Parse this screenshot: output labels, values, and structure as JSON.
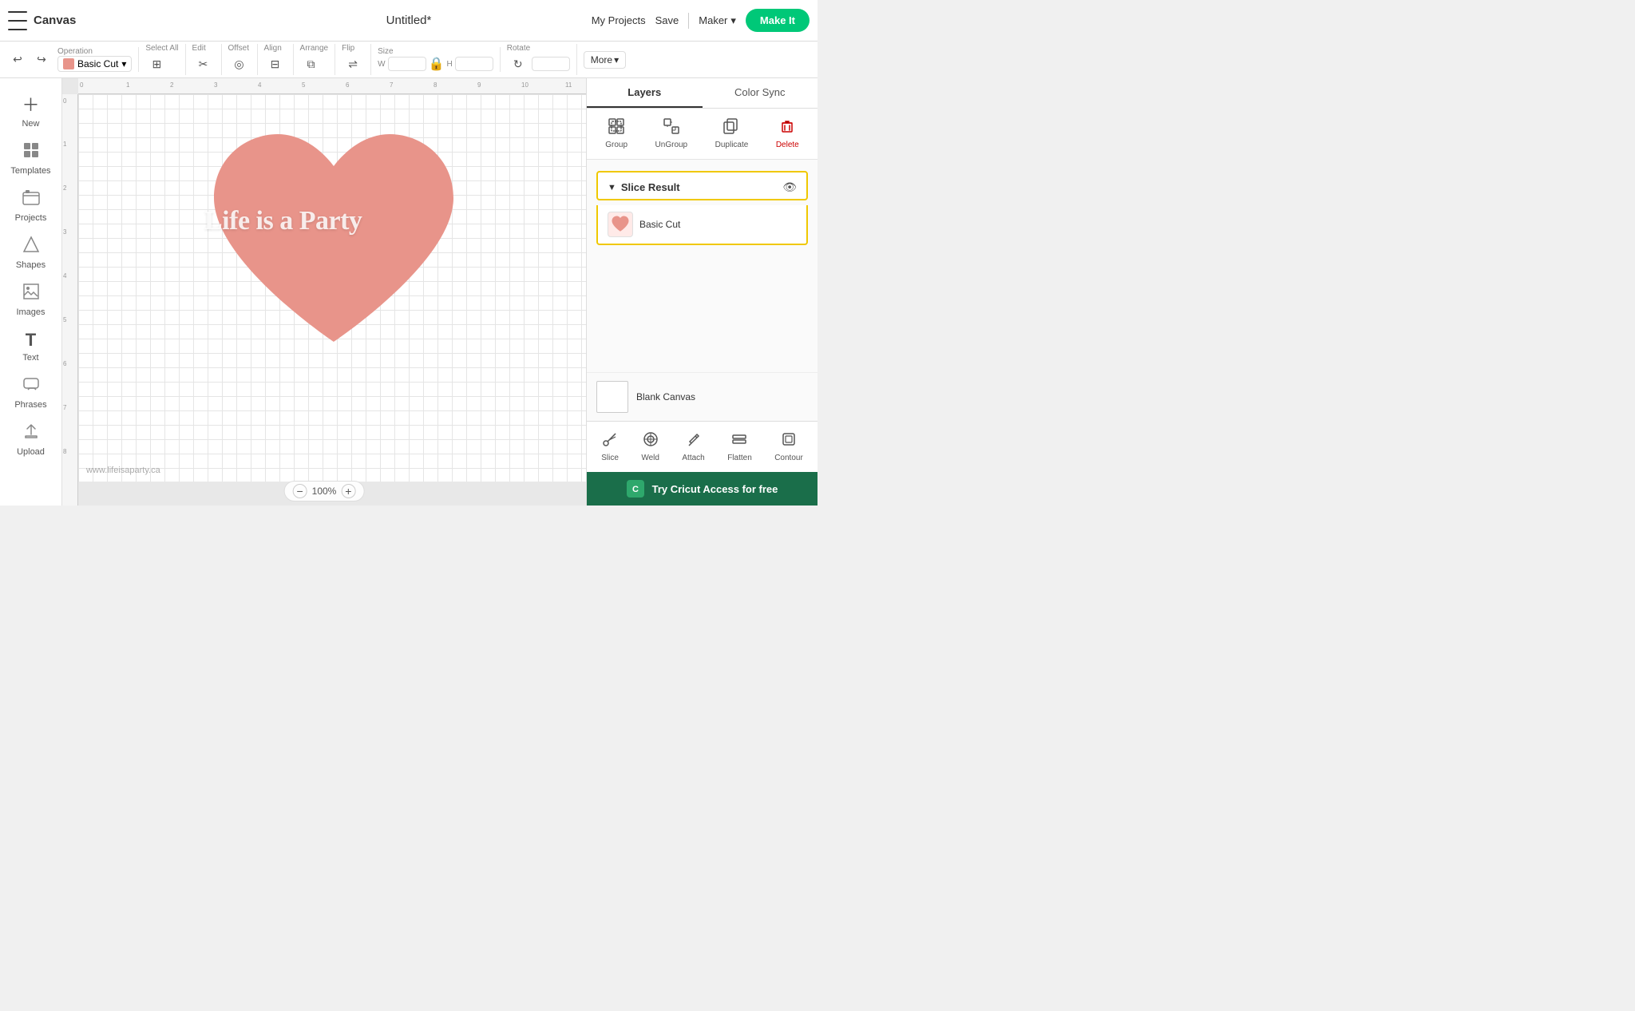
{
  "topbar": {
    "menu_label": "Menu",
    "app_title": "Canvas",
    "doc_title": "Untitled*",
    "my_projects": "My Projects",
    "save": "Save",
    "maker": "Maker",
    "make_it": "Make It"
  },
  "toolbar": {
    "undo_label": "Undo",
    "redo_label": "Redo",
    "operation_label": "Operation",
    "operation_value": "Basic Cut",
    "select_all_label": "Select All",
    "edit_label": "Edit",
    "offset_label": "Offset",
    "align_label": "Align",
    "arrange_label": "Arrange",
    "flip_label": "Flip",
    "size_label": "Size",
    "w_label": "W",
    "h_label": "H",
    "rotate_label": "Rotate",
    "more_label": "More"
  },
  "sidebar": {
    "items": [
      {
        "id": "new",
        "icon": "➕",
        "label": "New"
      },
      {
        "id": "templates",
        "icon": "▦",
        "label": "Templates"
      },
      {
        "id": "projects",
        "icon": "📁",
        "label": "Projects"
      },
      {
        "id": "shapes",
        "icon": "△",
        "label": "Shapes"
      },
      {
        "id": "images",
        "icon": "🌄",
        "label": "Images"
      },
      {
        "id": "text",
        "icon": "T",
        "label": "Text"
      },
      {
        "id": "phrases",
        "icon": "💬",
        "label": "Phrases"
      },
      {
        "id": "upload",
        "icon": "⬆",
        "label": "Upload"
      }
    ]
  },
  "canvas": {
    "watermark": "www.lifeisaparty.ca",
    "zoom_level": "100%",
    "heart_text": "Life is a Party",
    "grid_color": "#e5e5e5",
    "heart_color": "#e8948a"
  },
  "right_panel": {
    "tabs": [
      {
        "id": "layers",
        "label": "Layers",
        "active": true
      },
      {
        "id": "color_sync",
        "label": "Color Sync",
        "active": false
      }
    ],
    "actions": [
      {
        "id": "group",
        "label": "Group",
        "icon": "⊞"
      },
      {
        "id": "ungroup",
        "label": "UnGroup",
        "icon": "⊟"
      },
      {
        "id": "duplicate",
        "label": "Duplicate",
        "icon": "⧉"
      },
      {
        "id": "delete",
        "label": "Delete",
        "icon": "🗑",
        "danger": true
      }
    ],
    "slice_result": {
      "title": "Slice Result",
      "layer": {
        "name": "Basic Cut",
        "thumb_color": "#e8948a"
      }
    },
    "canvas_preview": {
      "label": "Blank Canvas"
    },
    "tools": [
      {
        "id": "slice",
        "label": "Slice",
        "icon": "✂"
      },
      {
        "id": "weld",
        "label": "Weld",
        "icon": "⊕"
      },
      {
        "id": "attach",
        "label": "Attach",
        "icon": "📎"
      },
      {
        "id": "flatten",
        "label": "Flatten",
        "icon": "⬛"
      },
      {
        "id": "contour",
        "label": "Contour",
        "icon": "◻"
      }
    ],
    "banner": {
      "label": "Try Cricut Access for free",
      "logo": "C"
    }
  },
  "ruler": {
    "h_marks": [
      "0",
      "1",
      "2",
      "3",
      "4",
      "5",
      "6",
      "7",
      "8",
      "9",
      "10",
      "11"
    ],
    "v_marks": [
      "0",
      "1",
      "2",
      "3",
      "4",
      "5",
      "6",
      "7",
      "8"
    ]
  }
}
